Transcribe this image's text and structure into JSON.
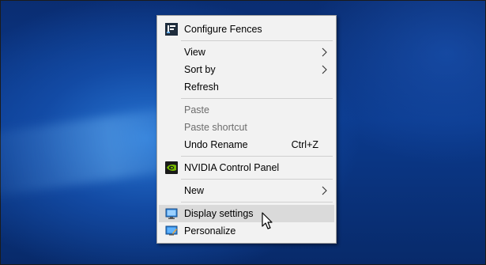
{
  "menu": {
    "configure_fences": "Configure Fences",
    "view": "View",
    "sort_by": "Sort by",
    "refresh": "Refresh",
    "paste": "Paste",
    "paste_shortcut": "Paste shortcut",
    "undo_rename": "Undo Rename",
    "undo_shortcut": "Ctrl+Z",
    "nvidia": "NVIDIA Control Panel",
    "new": "New",
    "display_settings": "Display settings",
    "personalize": "Personalize"
  },
  "colors": {
    "menu_background": "#f2f2f2",
    "hover_highlight": "#dadada",
    "disabled_text": "#6d6d6d",
    "nvidia_green": "#76b900"
  },
  "icons": {
    "fences": "fences-icon",
    "nvidia": "nvidia-icon",
    "display": "display-settings-icon",
    "personalize": "personalize-icon",
    "submenu": "chevron-right-icon"
  }
}
